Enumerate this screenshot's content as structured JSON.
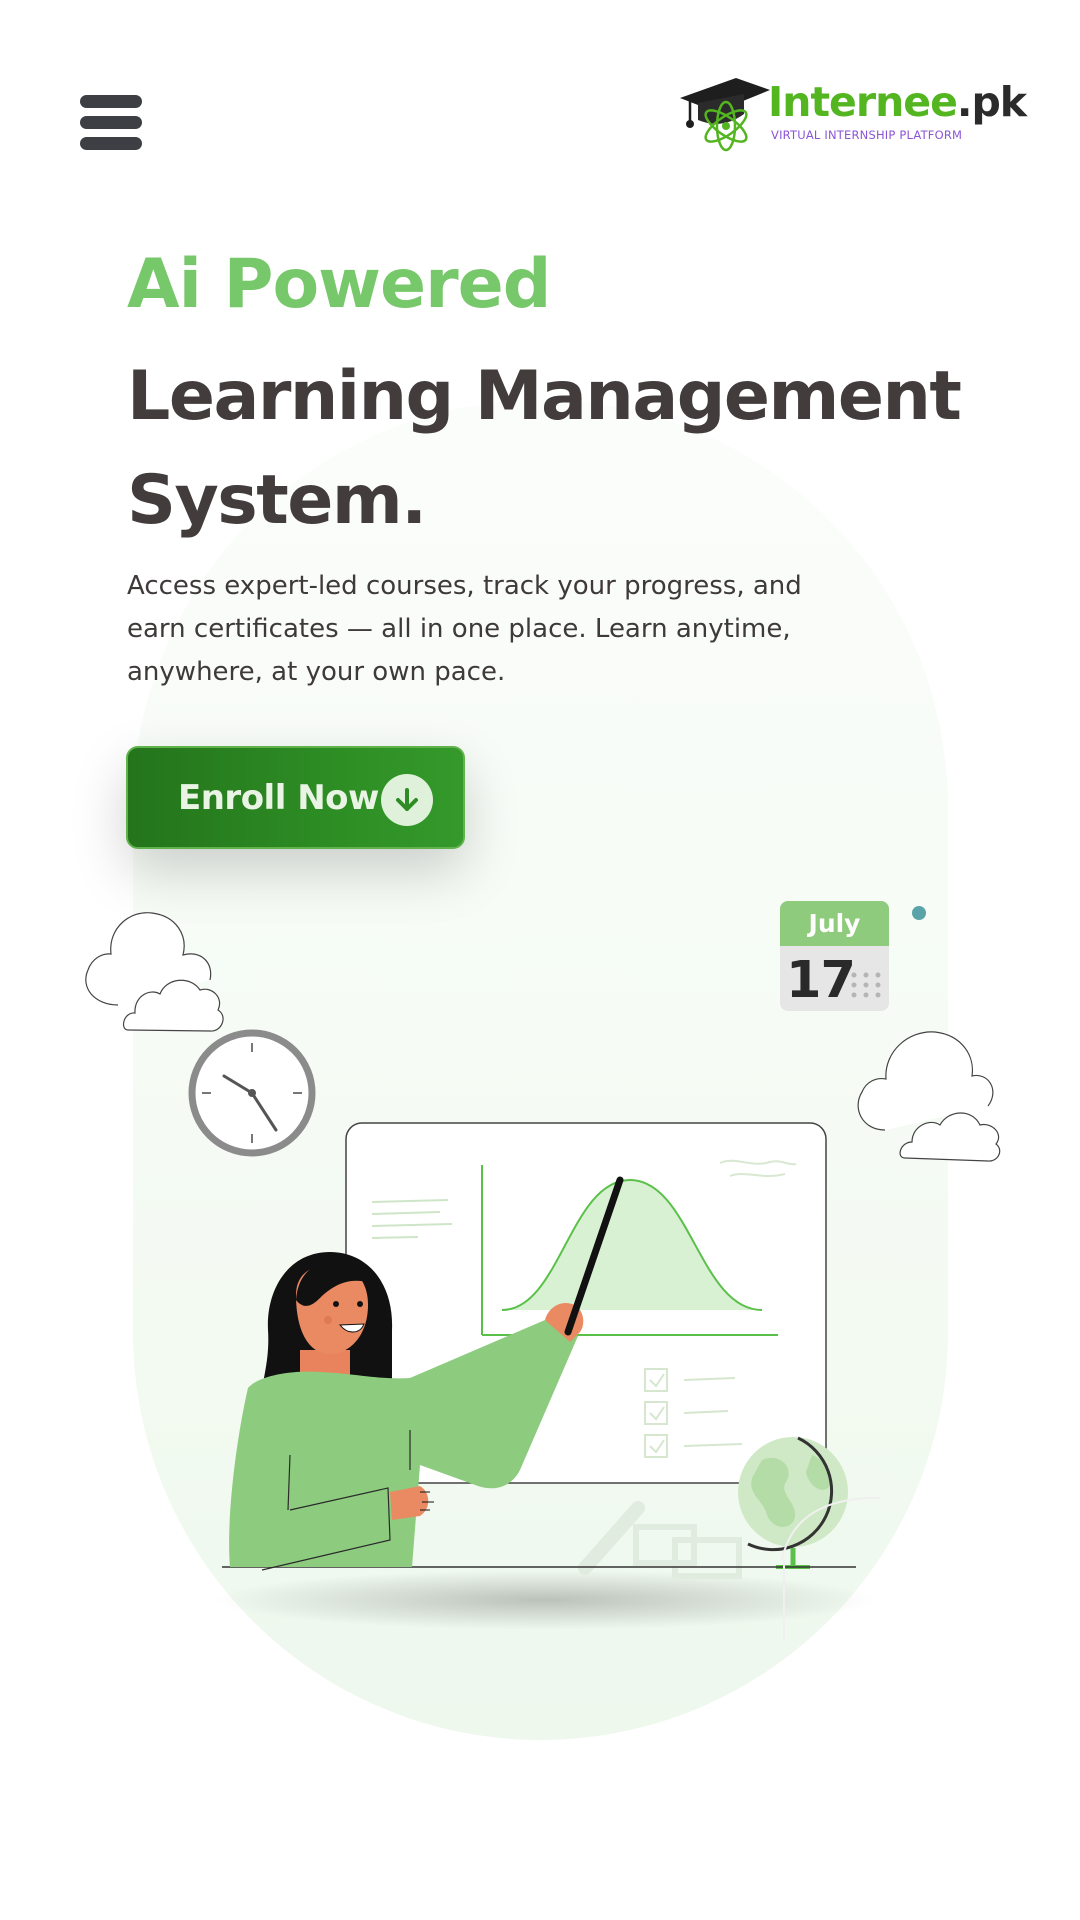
{
  "header": {
    "menu_icon": "hamburger-menu-icon",
    "logo": {
      "name": "Internee",
      "tld": ".pk",
      "tagline": "VIRTUAL INTERNSHIP PLATFORM",
      "icon": "graduation-cap-atom-icon"
    }
  },
  "hero": {
    "kicker": "Ai Powered",
    "title_line1": "Learning Management",
    "title_line2": "System.",
    "description": "Access expert-led courses, track your progress, and earn certificates — all in one place. Learn anytime, anywhere, at your own pace.",
    "cta_label": "Enroll Now",
    "cta_icon": "arrow-down-circle-icon"
  },
  "illustration": {
    "calendar_month": "July",
    "calendar_day": "17",
    "icons": [
      "clock-icon",
      "cloud-icon",
      "globe-icon",
      "calendar-icon",
      "presentation-board-icon"
    ]
  },
  "colors": {
    "accent_green": "#77c86a",
    "button_green": "#2d8d24",
    "heading_dark": "#433c3d",
    "logo_green": "#53b51f",
    "logo_purple": "#8b55d6"
  }
}
